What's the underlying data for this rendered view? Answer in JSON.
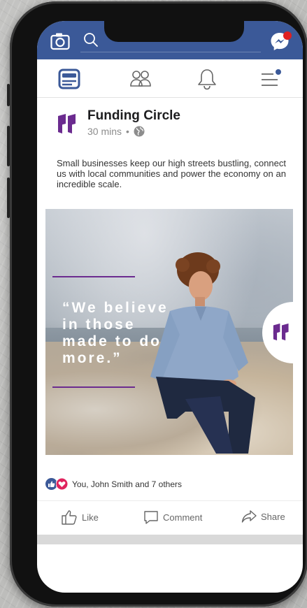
{
  "post": {
    "page_name": "Funding Circle",
    "time": "30 mins",
    "separator": "•",
    "text": "Small businesses keep our high streets bustling, connect us with local communities and power the economy on an incredible scale.",
    "quote": "“We believe\nin those\nmade to do\nmore.”"
  },
  "reactions": {
    "text": "You, John Smith and 7 others"
  },
  "actions": {
    "like": "Like",
    "comment": "Comment",
    "share": "Share"
  },
  "icons": {
    "camera": "camera-icon",
    "search": "search-icon",
    "messenger": "messenger-icon",
    "news_feed": "news-feed-icon",
    "friends": "friends-icon",
    "notifications": "bell-icon",
    "menu": "menu-icon",
    "globe": "globe-icon",
    "like_reaction": "like-reaction-icon",
    "love_reaction": "love-reaction-icon"
  },
  "colors": {
    "facebook_blue": "#3b5998",
    "brand_purple": "#6b2b8f",
    "notification_red": "#e02020"
  }
}
